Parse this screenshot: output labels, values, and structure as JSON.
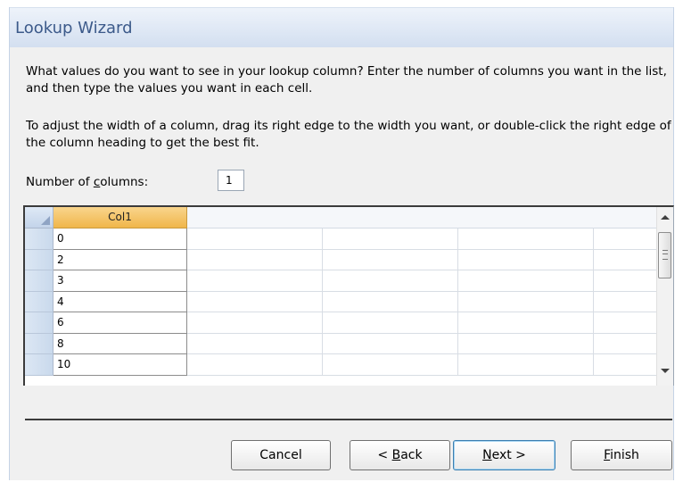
{
  "window": {
    "title": "Lookup Wizard"
  },
  "instructions": {
    "line1": "What values do you want to see in your lookup column? Enter the number of columns you want in the list, and then type the values you want in each cell.",
    "line2": "To adjust the width of a column, drag its right edge to the width you want, or double-click the right edge of the column heading to get the best fit."
  },
  "columns_field": {
    "label_pre": "Number of ",
    "label_u": "c",
    "label_post": "olumns:",
    "value": "1"
  },
  "grid": {
    "column_header": "Col1",
    "rows": [
      "0",
      "2",
      "3",
      "4",
      "6",
      "8",
      "10"
    ]
  },
  "buttons": {
    "cancel": "Cancel",
    "back_pre": "< ",
    "back_u": "B",
    "back_post": "ack",
    "next_u": "N",
    "next_post": "ext >",
    "finish_u": "F",
    "finish_post": "inish"
  }
}
